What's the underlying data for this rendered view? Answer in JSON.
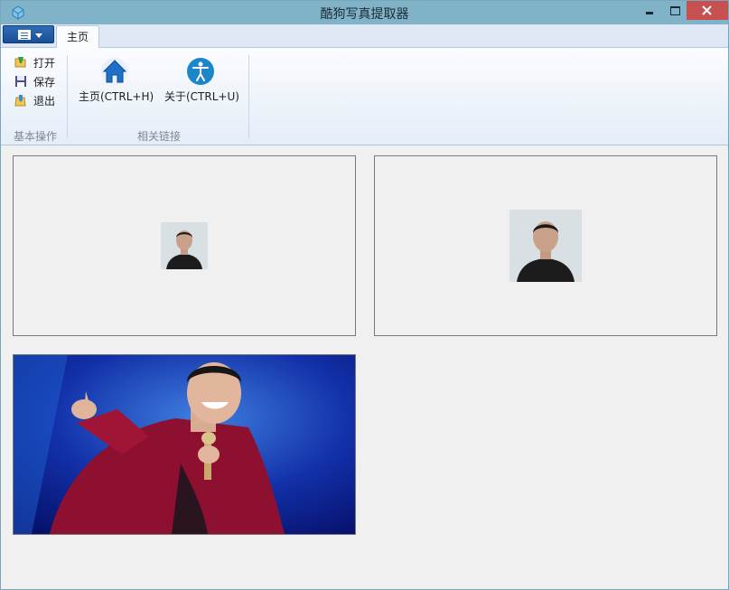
{
  "window": {
    "title": "酷狗写真提取器"
  },
  "tabs": [
    {
      "label": "主页",
      "selected": true
    }
  ],
  "ribbon": {
    "groups": [
      {
        "label": "基本操作",
        "buttons": [
          {
            "label": "打开",
            "icon": "open-folder-icon"
          },
          {
            "label": "保存",
            "icon": "floppy-disk-icon"
          },
          {
            "label": "退出",
            "icon": "exit-icon"
          }
        ]
      },
      {
        "label": "相关链接",
        "buttons": [
          {
            "label": "主页(CTRL+H)",
            "icon": "home-icon"
          },
          {
            "label": "关于(CTRL+U)",
            "icon": "accessibility-icon"
          }
        ]
      }
    ]
  },
  "images": [
    {
      "icon": "portrait-photo-small"
    },
    {
      "icon": "portrait-photo-medium"
    },
    {
      "icon": "concert-photo-large"
    }
  ],
  "colors": {
    "titlebar": "#80b3c8",
    "close_button": "#c75050",
    "ribbon_top": "#fbfcfe",
    "ribbon_bottom": "#e4edf8",
    "app_menu_button": "#2f6cb8"
  }
}
